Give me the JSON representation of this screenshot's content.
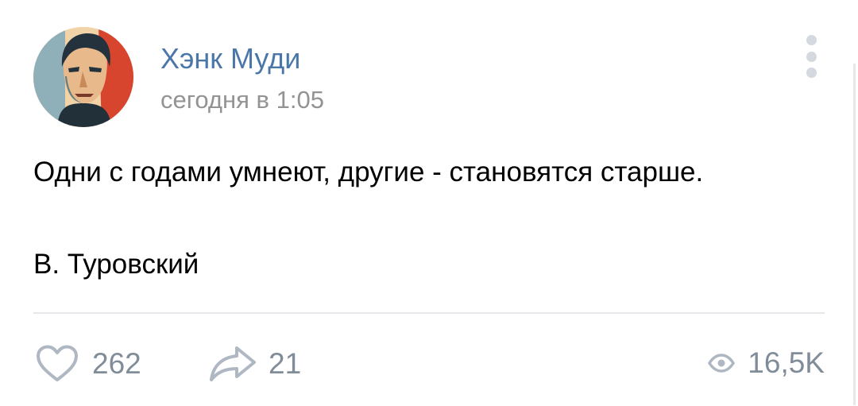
{
  "post": {
    "author": "Хэнк Муди",
    "time": "сегодня в 1:05",
    "text_line1": "Одни с годами умнеют, другие - становятся старше.",
    "text_line2": "В. Туровский"
  },
  "footer": {
    "likes": "262",
    "shares": "21",
    "views": "16,5K"
  },
  "icons": {
    "more": "more-vertical-icon",
    "like": "heart-icon",
    "share": "share-arrow-icon",
    "views": "eye-icon"
  },
  "colors": {
    "author": "#4a76a8",
    "meta": "#939393",
    "counter": "#818c99",
    "icon": "#aeb7c2",
    "divider": "#e7e8ec"
  }
}
